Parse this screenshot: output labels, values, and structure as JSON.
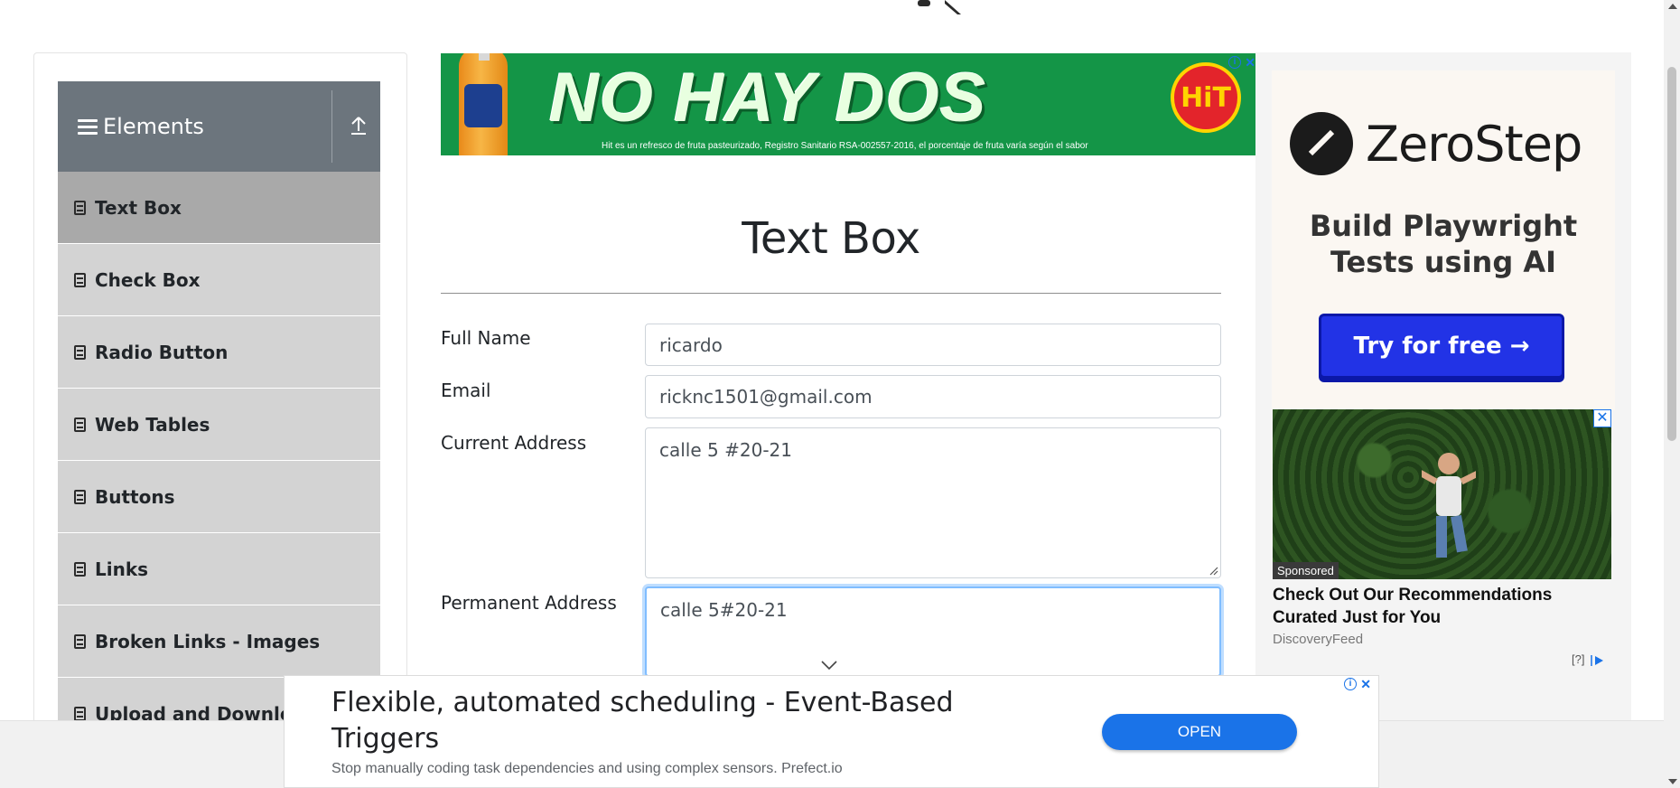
{
  "sidebar": {
    "group_title": "Elements",
    "items": [
      {
        "label": "Text Box",
        "active": true
      },
      {
        "label": "Check Box"
      },
      {
        "label": "Radio Button"
      },
      {
        "label": "Web Tables"
      },
      {
        "label": "Buttons"
      },
      {
        "label": "Links"
      },
      {
        "label": "Broken Links - Images"
      },
      {
        "label": "Upload and Download"
      }
    ]
  },
  "top_ad": {
    "headline": "NO HAY DOS",
    "brand": "HiT",
    "fine_print": "Hit es un refresco de fruta pasteurizado, Registro Sanitario RSA-002557-2016, el porcentaje de fruta varía según el sabor"
  },
  "main": {
    "title": "Text Box",
    "fields": {
      "full_name": {
        "label": "Full Name",
        "value": "ricardo"
      },
      "email": {
        "label": "Email",
        "value": "ricknc1501@gmail.com"
      },
      "current_address": {
        "label": "Current Address",
        "value": "calle 5 #20-21"
      },
      "permanent_address": {
        "label": "Permanent Address",
        "value": "calle 5#20-21"
      }
    }
  },
  "right_ad": {
    "brand": "ZeroStep",
    "tagline": "Build Playwright Tests using AI",
    "cta": "Try for free →",
    "sponsored_badge": "Sponsored",
    "sponsored_title": "Check Out Our Recommendations Curated Just for You",
    "sponsored_source": "DiscoveryFeed",
    "help": "[?]"
  },
  "bottom_ad": {
    "headline": "Flexible, automated scheduling - Event-Based Triggers",
    "description": "Stop manually coding task dependencies and using complex sensors. Prefect.io",
    "button": "OPEN"
  },
  "colors": {
    "sidebar_header": "#6c757d",
    "menu_item": "#d3d3d3",
    "menu_item_active": "#a9a9a9",
    "focus_border": "#80bdff",
    "ad_button_blue": "#1a73e8",
    "zerostep_button": "#2233e6",
    "banner_green": "#149547"
  }
}
